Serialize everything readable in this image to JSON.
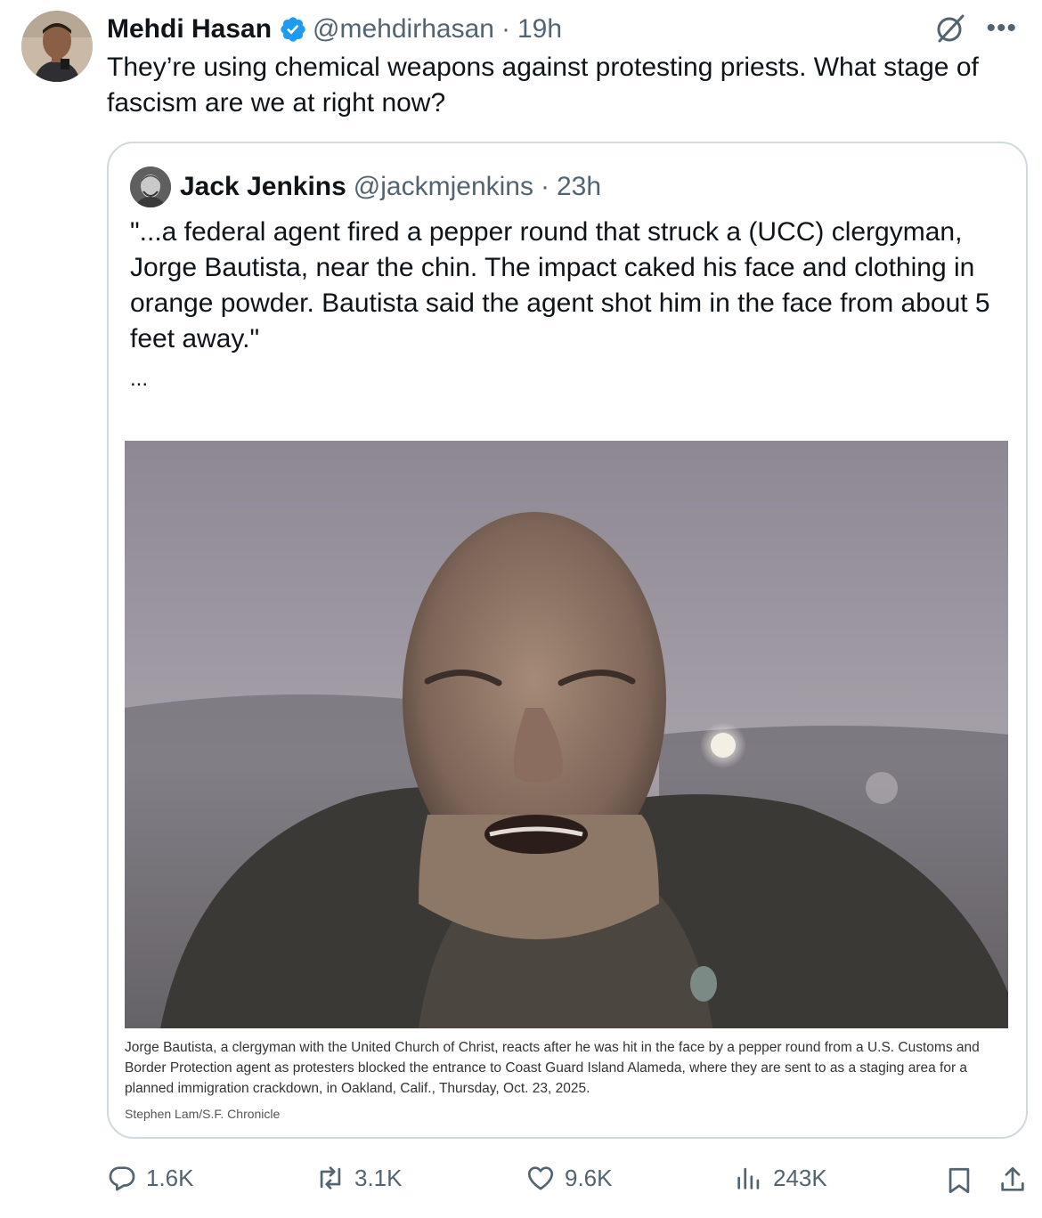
{
  "tweet": {
    "author_name": "Mehdi Hasan",
    "handle": "@mehdirhasan",
    "separator": "·",
    "time": "19h",
    "text": "They’re using chemical weapons against protesting priests. What stage of fascism are we at right now?"
  },
  "quote": {
    "author_name": "Jack Jenkins",
    "handle": "@jackmjenkins",
    "separator": "·",
    "time": "23h",
    "text": "\"...a federal agent fired a pepper round that struck a (UCC) clergyman, Jorge Bautista, near the chin. The impact caked his face and clothing in orange powder. Bautista said the agent shot him in the face from about 5 feet away.\"",
    "ellipsis": "...",
    "caption": "Jorge Bautista, a clergyman with the United Church of Christ, reacts after he was hit in the face by a pepper round from a U.S. Customs and Border Protection agent as protesters blocked the entrance to Coast Guard Island Alameda, where they are sent to as a staging area for a planned immigration crackdown, in Oakland, Calif., Thursday, Oct. 23, 2025.",
    "credit": "Stephen Lam/S.F. Chronicle"
  },
  "actions": {
    "replies": "1.6K",
    "reposts": "3.1K",
    "likes": "9.6K",
    "views": "243K"
  },
  "icons": {
    "verified": "verified-badge-icon",
    "grok": "grok-icon",
    "more": "more-icon",
    "reply": "reply-icon",
    "repost": "repost-icon",
    "like": "like-icon",
    "views": "views-icon",
    "bookmark": "bookmark-icon",
    "share": "share-icon"
  },
  "colors": {
    "verified": "#1d9bf0",
    "text": "#0f1419",
    "secondary": "#536471",
    "border": "#cfd9de"
  }
}
